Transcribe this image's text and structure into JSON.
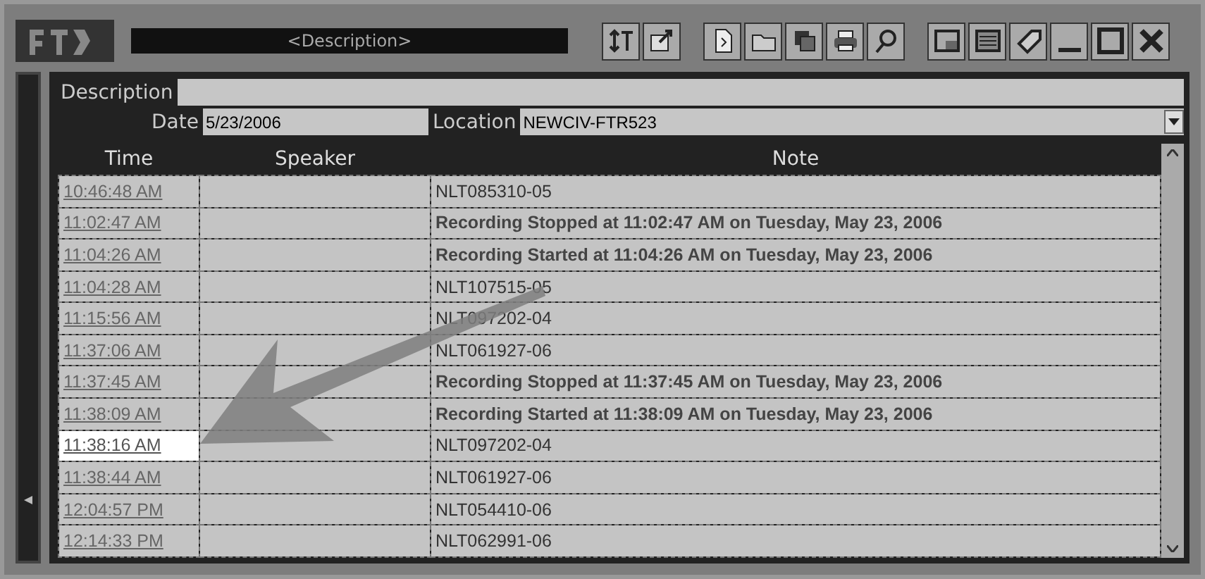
{
  "title_field": {
    "placeholder": "<Description>"
  },
  "form": {
    "description_label": "Description",
    "date_label": "Date",
    "date_value": "5/23/2006",
    "location_label": "Location",
    "location_value": "NEWCIV-FTR523"
  },
  "table": {
    "columns": [
      "Time",
      "Speaker",
      "Note"
    ],
    "rows": [
      {
        "time": "10:46:48 AM",
        "speaker": "",
        "note": "NLT085310-05",
        "kind": "note",
        "selected": false
      },
      {
        "time": "11:02:47 AM",
        "speaker": "",
        "note": "Recording Stopped at 11:02:47 AM on Tuesday, May 23, 2006",
        "kind": "event",
        "selected": false
      },
      {
        "time": "11:04:26 AM",
        "speaker": "",
        "note": "Recording Started at 11:04:26 AM on Tuesday, May 23, 2006",
        "kind": "event",
        "selected": false
      },
      {
        "time": "11:04:28 AM",
        "speaker": "",
        "note": "NLT107515-05",
        "kind": "note",
        "selected": false
      },
      {
        "time": "11:15:56 AM",
        "speaker": "",
        "note": "NLT097202-04",
        "kind": "note",
        "selected": false
      },
      {
        "time": "11:37:06 AM",
        "speaker": "",
        "note": "NLT061927-06",
        "kind": "note",
        "selected": false
      },
      {
        "time": "11:37:45 AM",
        "speaker": "",
        "note": "Recording Stopped at 11:37:45 AM on Tuesday, May 23, 2006",
        "kind": "event",
        "selected": false
      },
      {
        "time": "11:38:09 AM",
        "speaker": "",
        "note": "Recording Started at 11:38:09 AM on Tuesday, May 23, 2006",
        "kind": "event",
        "selected": false
      },
      {
        "time": "11:38:16 AM",
        "speaker": "",
        "note": "NLT097202-04",
        "kind": "note",
        "selected": true
      },
      {
        "time": "11:38:44 AM",
        "speaker": "",
        "note": "NLT061927-06",
        "kind": "note",
        "selected": false
      },
      {
        "time": "12:04:57 PM",
        "speaker": "",
        "note": "NLT054410-06",
        "kind": "note",
        "selected": false
      },
      {
        "time": "12:14:33 PM",
        "speaker": "",
        "note": "NLT062991-06",
        "kind": "note",
        "selected": false
      }
    ]
  }
}
